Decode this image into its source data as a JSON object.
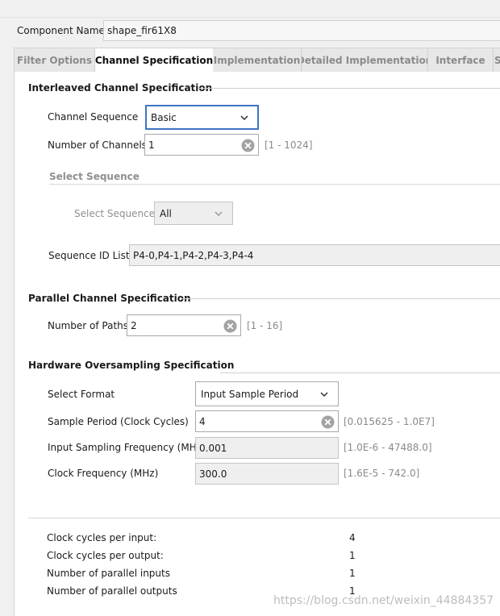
{
  "component": {
    "label": "Component Name",
    "value": "shape_fir61X8"
  },
  "tabs": [
    {
      "label": "Filter Options",
      "active": false
    },
    {
      "label": "Channel Specification",
      "active": true
    },
    {
      "label": "Implementation",
      "active": false
    },
    {
      "label": "Detailed Implementation",
      "active": false
    },
    {
      "label": "Interface",
      "active": false
    },
    {
      "label": "S",
      "active": false
    }
  ],
  "interleaved": {
    "title": "Interleaved Channel Specification",
    "channel_sequence": {
      "label": "Channel Sequence",
      "value": "Basic"
    },
    "num_channels": {
      "label": "Number of Channels",
      "value": "1",
      "range": "[1 - 1024]"
    },
    "select_sequence_section": {
      "title": "Select Sequence",
      "label": "Select Sequence",
      "value": "All"
    },
    "sequence_id_list": {
      "label": "Sequence ID List",
      "value": "P4-0,P4-1,P4-2,P4-3,P4-4"
    }
  },
  "parallel": {
    "title": "Parallel Channel Specification",
    "num_paths": {
      "label": "Number of Paths",
      "value": "2",
      "range": "[1 - 16]"
    }
  },
  "hardware": {
    "title": "Hardware Oversampling Specification",
    "select_format": {
      "label": "Select Format",
      "value": "Input Sample Period"
    },
    "sample_period": {
      "label": "Sample Period (Clock Cycles)",
      "value": "4",
      "range": "[0.015625 - 1.0E7]"
    },
    "input_sampling_freq": {
      "label": "Input Sampling Frequency (MHz)",
      "value": "0.001",
      "range": "[1.0E-6 - 47488.0]"
    },
    "clock_freq": {
      "label": "Clock Frequency (MHz)",
      "value": "300.0",
      "range": "[1.6E-5 - 742.0]"
    }
  },
  "summary": [
    {
      "label": "Clock cycles per input:",
      "value": "4"
    },
    {
      "label": "Clock cycles per output:",
      "value": "1"
    },
    {
      "label": "Number of parallel inputs",
      "value": "1"
    },
    {
      "label": "Number of parallel outputs",
      "value": "1"
    }
  ],
  "watermark": "https://blog.csdn.net/weixin_44884357",
  "colors": {
    "focus_border": "#3f74c4",
    "disabled_text": "#8f8f8f",
    "range_text": "#8a8a8a"
  }
}
